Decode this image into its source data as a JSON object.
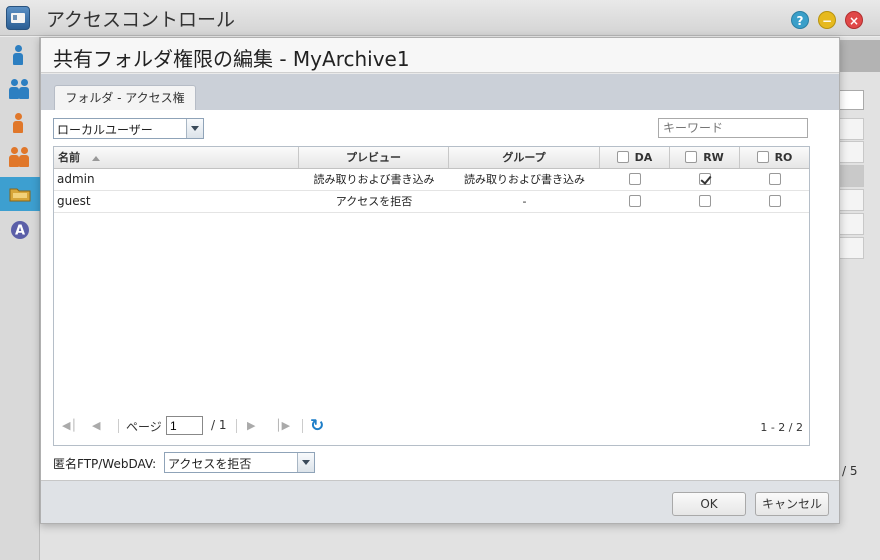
{
  "app": {
    "title": "アクセスコントロール"
  },
  "window_controls": {
    "help": "?",
    "minimize": "−",
    "close": "×"
  },
  "sidebar": {
    "items": [
      {
        "icon": "user-icon"
      },
      {
        "icon": "users-icon"
      },
      {
        "icon": "domain-user-icon"
      },
      {
        "icon": "domain-group-icon"
      },
      {
        "icon": "shared-folder-icon",
        "active": true
      },
      {
        "icon": "advanced-icon"
      }
    ]
  },
  "background": {
    "pager_text": "/ 5"
  },
  "modal": {
    "title": "共有フォルダ権限の編集 - MyArchive1",
    "tab": "フォルダ - アクセス権",
    "user_type_select": "ローカルユーザー",
    "search_placeholder": "キーワード",
    "columns": {
      "name": "名前",
      "preview": "プレビュー",
      "group": "グループ",
      "da": "DA",
      "rw": "RW",
      "ro": "RO"
    },
    "rows": [
      {
        "name": "admin",
        "preview": "読み取りおよび書き込み",
        "group": "読み取りおよび書き込み",
        "da": false,
        "rw": true,
        "ro": false
      },
      {
        "name": "guest",
        "preview": "アクセスを拒否",
        "group": "-",
        "da": false,
        "rw": false,
        "ro": false
      }
    ],
    "pager": {
      "page_label": "ページ",
      "page_value": "1",
      "total_pages": "/ 1",
      "info": "1 - 2 / 2"
    },
    "anonymous": {
      "label": "匿名FTP/WebDAV:",
      "value": "アクセスを拒否"
    },
    "buttons": {
      "ok": "OK",
      "cancel": "キャンセル"
    }
  }
}
